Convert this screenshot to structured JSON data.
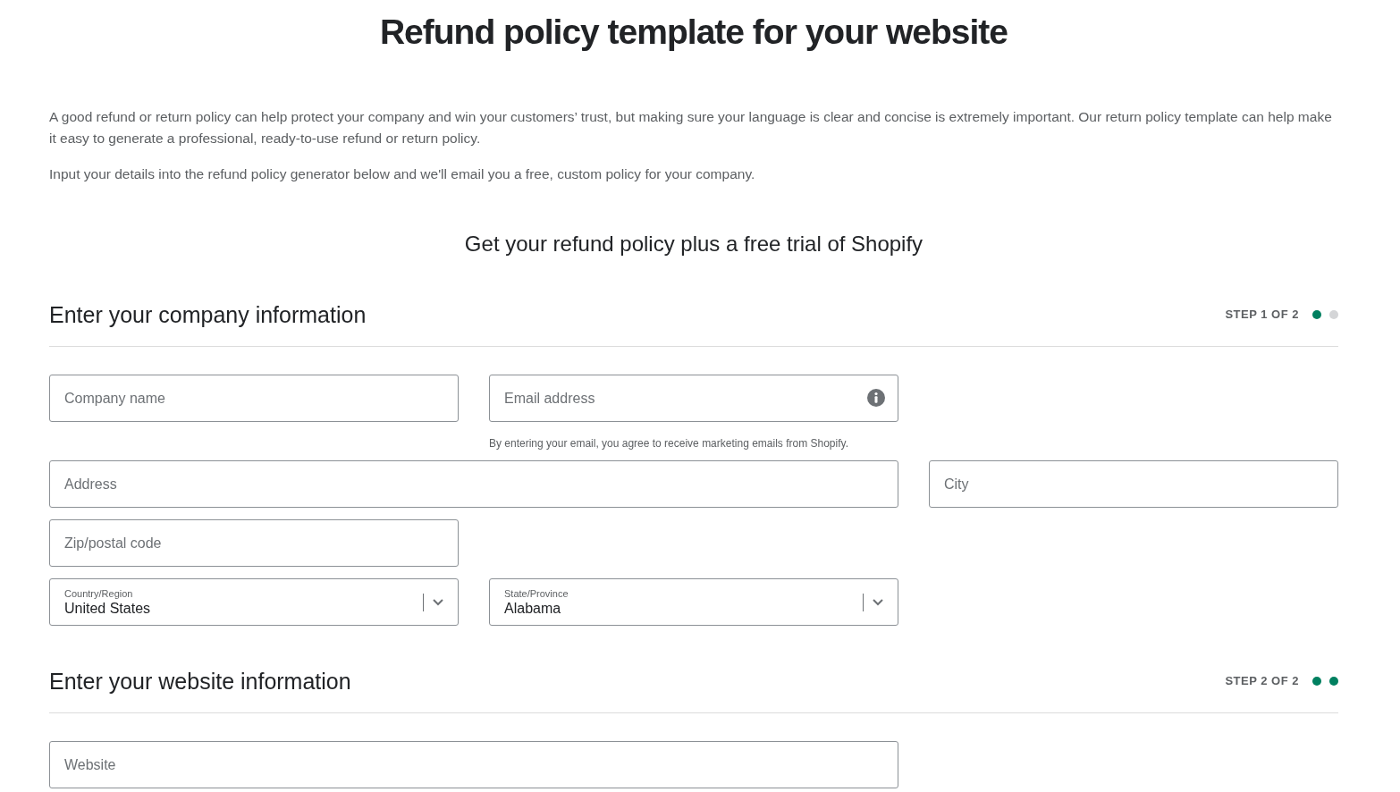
{
  "title": "Refund policy template for your website",
  "intro": [
    "A good refund or return policy can help protect your company and win your customers’ trust, but making sure your language is clear and concise is extremely important. Our return policy template can help make it easy to generate a professional, ready-to-use refund or return policy.",
    "Input your details into the refund policy generator below and we'll email you a free, custom policy for your company."
  ],
  "subtitle": "Get your refund policy plus a free trial of Shopify",
  "sections": [
    {
      "title": "Enter your company information",
      "step": "STEP 1 OF 2",
      "step_dots": [
        {
          "filled": true
        },
        {
          "filled": false
        }
      ],
      "fields": [
        {
          "kind": "text",
          "placeholder": "Company name",
          "wide": false
        },
        {
          "kind": "email",
          "placeholder": "Email address",
          "hint": "By entering your email, you agree to receive marketing emails from Shopify.",
          "wide": false
        },
        {
          "kind": "break"
        },
        {
          "kind": "text",
          "placeholder": "Address",
          "wide": true
        },
        {
          "kind": "text",
          "placeholder": "City",
          "wide": false
        },
        {
          "kind": "text",
          "placeholder": "Zip/postal code",
          "wide": false
        },
        {
          "kind": "break"
        },
        {
          "kind": "select",
          "label": "Country/Region",
          "value": "United States",
          "wide": false
        },
        {
          "kind": "select",
          "label": "State/Province",
          "value": "Alabama",
          "wide": false
        }
      ]
    },
    {
      "title": "Enter your website information",
      "step": "STEP 2 OF 2",
      "step_dots": [
        {
          "filled": true
        },
        {
          "filled": true
        }
      ],
      "fields": [
        {
          "kind": "text",
          "placeholder": "Website",
          "wide": true
        }
      ]
    }
  ]
}
